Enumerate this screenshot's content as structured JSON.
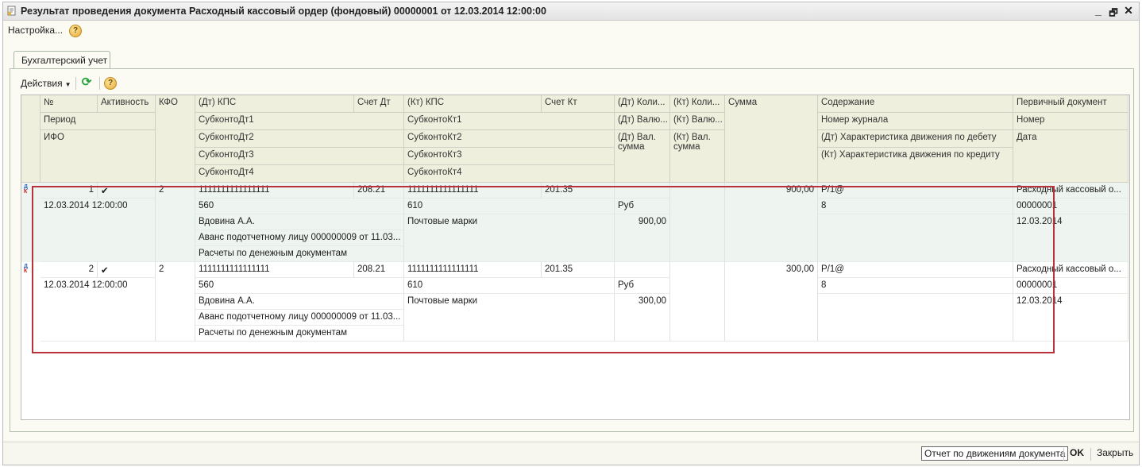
{
  "window": {
    "title": "Результат проведения документа Расходный кассовый ордер (фондовый) 00000001 от 12.03.2014 12:00:00",
    "minimize": "_",
    "restore": "🗗",
    "close": "✕"
  },
  "cmdbar": {
    "settings": "Настройка...",
    "help": "?"
  },
  "tab": {
    "label": "Бухгалтерский учет"
  },
  "toolbar": {
    "actions": "Действия",
    "help": "?"
  },
  "headers": {
    "num": "№",
    "active": "Активность",
    "kfo": "КФО",
    "period": "Период",
    "ifo": "ИФО",
    "dt_kps": "(Дт) КПС",
    "schet_dt": "Счет Дт",
    "subkonto_dt1": "СубконтоДт1",
    "subkonto_dt2": "СубконтоДт2",
    "subkonto_dt3": "СубконтоДт3",
    "subkonto_dt4": "СубконтоДт4",
    "kt_kps": "(Кт) КПС",
    "schet_kt": "Счет Кт",
    "subkonto_kt1": "СубконтоКт1",
    "subkonto_kt2": "СубконтоКт2",
    "subkonto_kt3": "СубконтоКт3",
    "subkonto_kt4": "СубконтоКт4",
    "dt_qty": "(Дт) Коли...",
    "dt_cur": "(Дт) Валю...",
    "dt_cur_sum": "(Дт) Вал. сумма",
    "kt_qty": "(Кт) Коли...",
    "kt_cur": "(Кт) Валю...",
    "kt_cur_sum": "(Кт) Вал. сумма",
    "sum": "Сумма",
    "content": "Содержание",
    "journal": "Номер журнала",
    "dt_char": "(Дт) Характеристика движения по дебету",
    "kt_char": "(Кт) Характеристика движения по кредиту",
    "primary_doc": "Первичный документ",
    "number": "Номер",
    "date": "Дата"
  },
  "rows": [
    {
      "num": "1",
      "active": "✔",
      "kfo": "2",
      "period": "12.03.2014 12:00:00",
      "dt_kps": "1111111111111111",
      "schet_dt": "208.21",
      "subkonto_dt1": "560",
      "subkonto_dt2": "Вдовина А.А.",
      "subkonto_dt3": "Аванс подотчетному лицу 000000009 от 11.03...",
      "subkonto_dt4": "Расчеты по денежным документам",
      "kt_kps": "1111111111111111",
      "schet_kt": "201.35",
      "subkonto_kt1": "610",
      "subkonto_kt2": "Почтовые марки",
      "dt_cur": "Руб",
      "dt_cur_sum": "900,00",
      "sum": "900,00",
      "content": "Р/1@",
      "journal": "8",
      "primary_doc": "Расходный кассовый о...",
      "number": "00000001",
      "date": "12.03.2014"
    },
    {
      "num": "2",
      "active": "✔",
      "kfo": "2",
      "period": "12.03.2014 12:00:00",
      "dt_kps": "1111111111111111",
      "schet_dt": "208.21",
      "subkonto_dt1": "560",
      "subkonto_dt2": "Вдовина А.А.",
      "subkonto_dt3": "Аванс подотчетному лицу 000000009 от 11.03...",
      "subkonto_dt4": "Расчеты по денежным документам",
      "kt_kps": "1111111111111111",
      "schet_kt": "201.35",
      "subkonto_kt1": "610",
      "subkonto_kt2": "Почтовые марки",
      "dt_cur": "Руб",
      "dt_cur_sum": "300,00",
      "sum": "300,00",
      "content": "Р/1@",
      "journal": "8",
      "primary_doc": "Расходный кассовый о...",
      "number": "00000001",
      "date": "12.03.2014"
    }
  ],
  "bottom": {
    "report": "Отчет по движениям документа",
    "ok": "OK",
    "close": "Закрыть"
  }
}
